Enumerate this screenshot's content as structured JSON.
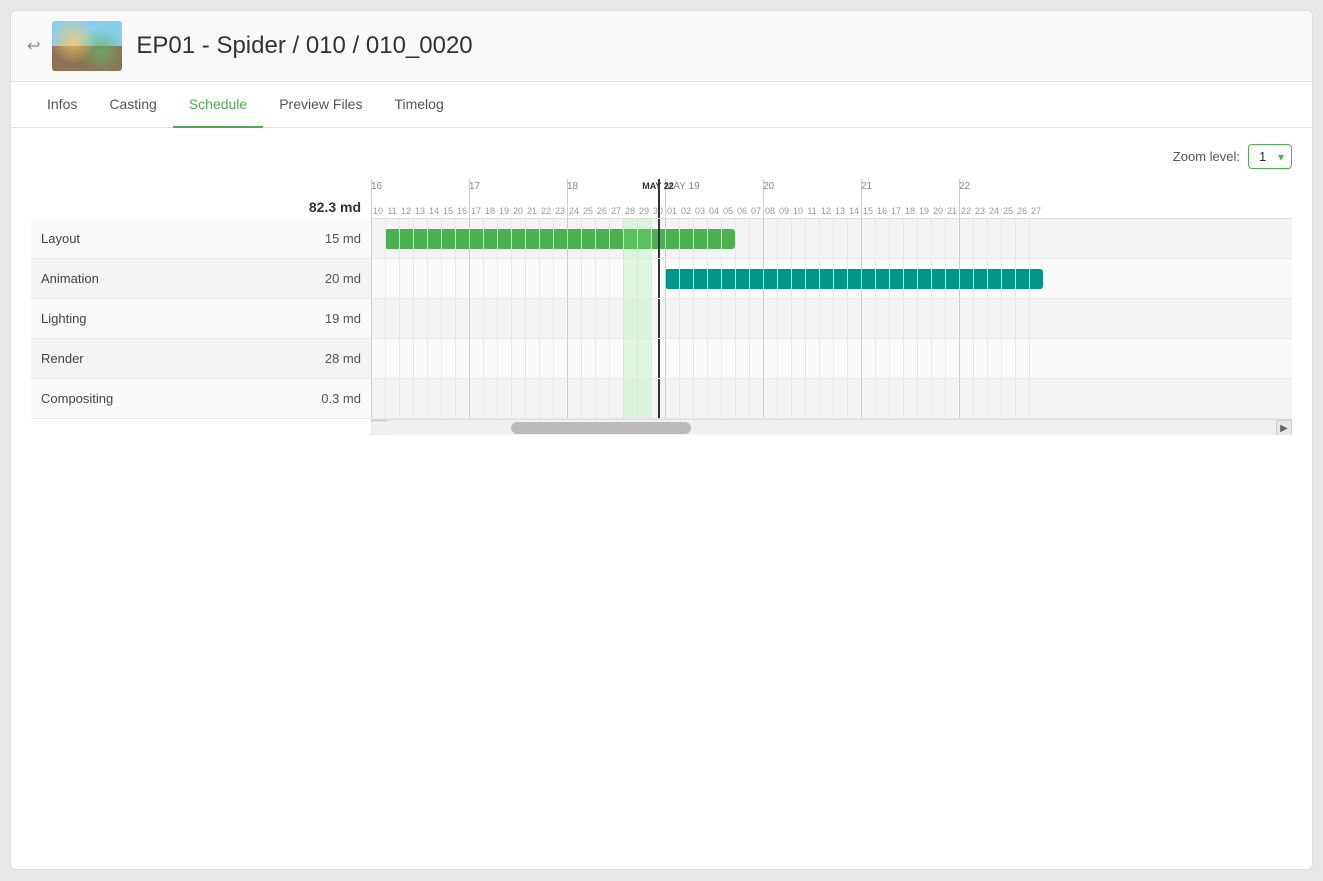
{
  "header": {
    "back_label": "←",
    "title": "EP01 - Spider / 010 / 010_0020"
  },
  "tabs": [
    {
      "id": "infos",
      "label": "Infos",
      "active": false
    },
    {
      "id": "casting",
      "label": "Casting",
      "active": false
    },
    {
      "id": "schedule",
      "label": "Schedule",
      "active": true
    },
    {
      "id": "preview-files",
      "label": "Preview Files",
      "active": false
    },
    {
      "id": "timelog",
      "label": "Timelog",
      "active": false
    }
  ],
  "zoom": {
    "label": "Zoom level:",
    "value": "1"
  },
  "gantt": {
    "total": "82.3 md",
    "rows": [
      {
        "name": "Layout",
        "days": "15 md"
      },
      {
        "name": "Animation",
        "days": "20 md"
      },
      {
        "name": "Lighting",
        "days": "19 md"
      },
      {
        "name": "Render",
        "days": "28 md"
      },
      {
        "name": "Compositing",
        "days": "0.3 md"
      }
    ],
    "today_label": "MAY 22"
  }
}
